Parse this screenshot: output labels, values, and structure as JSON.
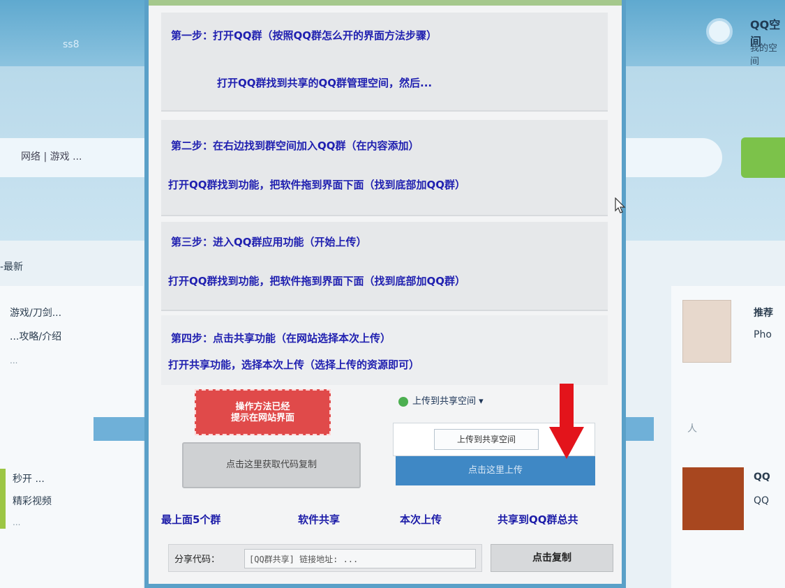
{
  "background": {
    "logo_text": "ss8",
    "right_title": "QQ空间",
    "right_sub": "我的空间",
    "search_text": "网络 | 游戏   ...",
    "section_label": "-最新",
    "left_item_title": "游戏/刀剑...",
    "left_item_sub": "...攻略/介绍",
    "left_item_meta": "...",
    "left_item2_title": "秒开   ...",
    "left_item2_sub": "精彩视频",
    "left_item2_meta": "...",
    "right_item_title": "推荐",
    "right_item_sub": "Pho",
    "right_tag": "人",
    "right_item2_title": "QQ",
    "right_item2_sub": "QQ"
  },
  "panel": {
    "steps": [
      {
        "line1": "第一步：打开QQ群（按照QQ群怎么开的界面方法步骤）",
        "line2": "打开QQ群找到共享的QQ群管理空间，然后..."
      },
      {
        "line1": "第二步：在右边找到群空间加入QQ群（在内容添加）",
        "line2": "打开QQ群找到功能，把软件拖到界面下面（找到底部加QQ群）"
      },
      {
        "line1": "第三步：进入QQ群应用功能（开始上传）",
        "line2": "打开QQ群找到功能，把软件拖到界面下面（找到底部加QQ群）"
      },
      {
        "line1": "第四步：点击共享功能（在网站选择本次上传）",
        "line2": "打开共享功能，选择本次上传（选择上传的资源即可）"
      }
    ],
    "red_banner_line1": "操作方法已经",
    "red_banner_line2": "提示在网站界面",
    "gray_button": "点击这里获取代码复制",
    "upload_label": "上传到共享空间 ▾",
    "upload_menu_item": "上传到共享空间",
    "upload_blue_button": "点击这里上传",
    "bottom_links": [
      "最上面5个群",
      "软件共享",
      "本次上传",
      "共享到QQ群总共"
    ],
    "code_label": "分享代码：",
    "code_value": "[QQ群共享] 链接地址: ...",
    "copy_button": "点击复制"
  }
}
